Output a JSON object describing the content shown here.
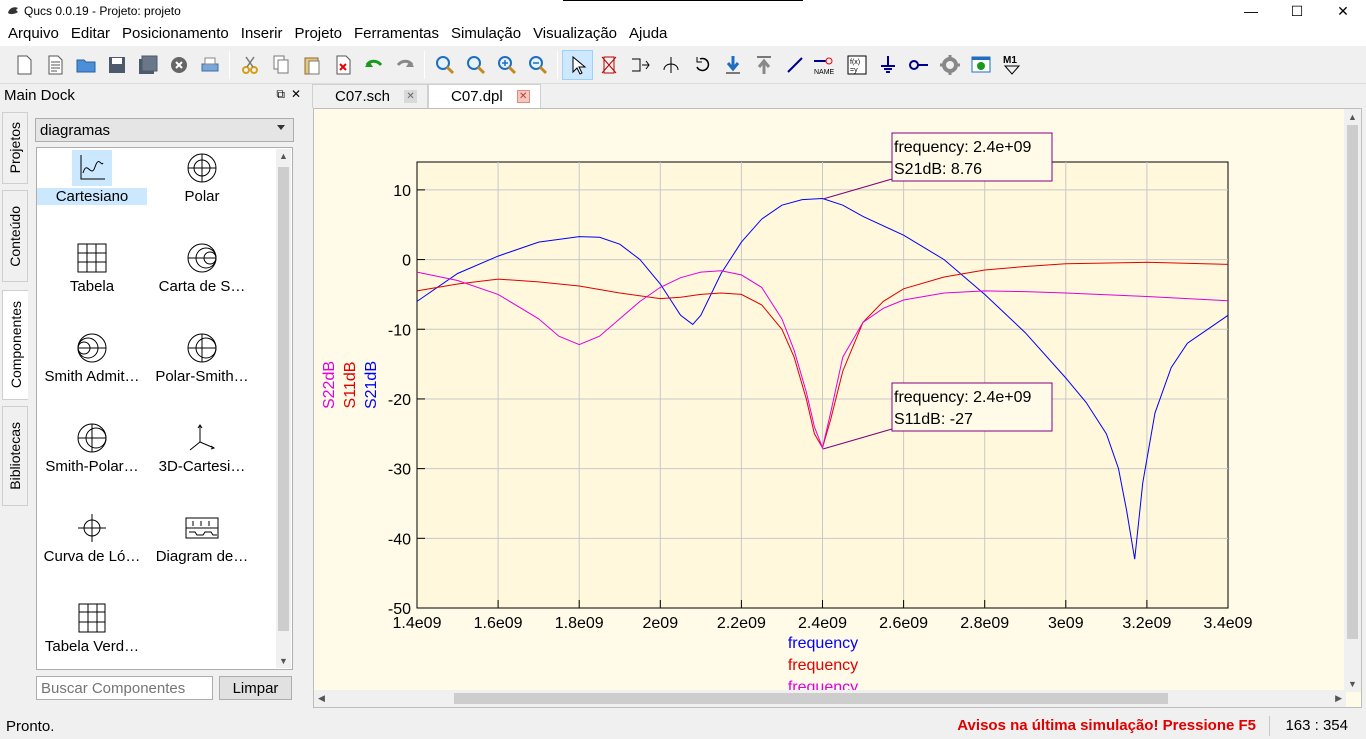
{
  "window": {
    "title": "Qucs 0.0.19 - Projeto: projeto",
    "minimize": "—",
    "maximize": "☐",
    "close": "✕"
  },
  "menu": [
    "Arquivo",
    "Editar",
    "Posicionamento",
    "Inserir",
    "Projeto",
    "Ferramentas",
    "Simulação",
    "Visualização",
    "Ajuda"
  ],
  "dock": {
    "title": "Main Dock",
    "side_tabs": [
      "Projetos",
      "Conteúdo",
      "Componentes",
      "Bibliotecas"
    ],
    "category": "diagramas",
    "components": [
      {
        "label": "Cartesiano",
        "icon": "cartesian-diagram-icon"
      },
      {
        "label": "Polar",
        "icon": "polar-diagram-icon"
      },
      {
        "label": "Tabela",
        "icon": "table-diagram-icon"
      },
      {
        "label": "Carta de S…",
        "icon": "smith-chart-icon"
      },
      {
        "label": "Smith Admit…",
        "icon": "smith-admittance-icon"
      },
      {
        "label": "Polar-Smith…",
        "icon": "polar-smith-icon"
      },
      {
        "label": "Smith-Polar…",
        "icon": "smith-polar-icon"
      },
      {
        "label": "3D-Cartesi…",
        "icon": "3d-cartesian-icon"
      },
      {
        "label": "Curva de Ló…",
        "icon": "locus-curve-icon"
      },
      {
        "label": "Diagram de…",
        "icon": "timing-diagram-icon"
      },
      {
        "label": "Tabela Verd…",
        "icon": "truth-table-icon"
      }
    ],
    "search_placeholder": "Buscar Componentes",
    "clear_label": "Limpar"
  },
  "tabs": [
    {
      "label": "C07.sch",
      "active": false
    },
    {
      "label": "C07.dpl",
      "active": true
    }
  ],
  "markers": [
    {
      "line1": "frequency: 2.4e+09",
      "line2": "S21dB: 8.76"
    },
    {
      "line1": "frequency: 2.4e+09",
      "line2": "S11dB: -27"
    }
  ],
  "chart_data": {
    "type": "line",
    "xlabel": "frequency",
    "xlim": [
      1400000000,
      3400000000
    ],
    "ylim": [
      -50,
      14
    ],
    "x_ticks": [
      "1.4e09",
      "1.6e09",
      "1.8e09",
      "2e09",
      "2.2e09",
      "2.4e09",
      "2.6e09",
      "2.8e09",
      "3e09",
      "3.2e09",
      "3.4e09"
    ],
    "y_ticks": [
      "10",
      "0",
      "-10",
      "-20",
      "-30",
      "-40",
      "-50"
    ],
    "y_tick_values": [
      10,
      0,
      -10,
      -20,
      -30,
      -40,
      -50
    ],
    "grid": true,
    "x_axis_labels": [
      "frequency",
      "frequency",
      "frequency"
    ],
    "x_axis_label_colors": [
      "#0000ff",
      "#e00000",
      "#e000e0"
    ],
    "y_axis_labels": [
      "S22dB",
      "S11dB",
      "S21dB"
    ],
    "y_axis_label_colors": [
      "#e000e0",
      "#e00000",
      "#0000ff"
    ],
    "series": [
      {
        "name": "S21dB",
        "color": "#0000ff",
        "x": [
          1400000000.0,
          1500000000.0,
          1600000000.0,
          1700000000.0,
          1800000000.0,
          1850000000.0,
          1900000000.0,
          1950000000.0,
          2000000000.0,
          2050000000.0,
          2080000000.0,
          2100000000.0,
          2150000000.0,
          2200000000.0,
          2250000000.0,
          2300000000.0,
          2350000000.0,
          2400000000.0,
          2450000000.0,
          2500000000.0,
          2600000000.0,
          2700000000.0,
          2800000000.0,
          2900000000.0,
          3000000000.0,
          3050000000.0,
          3100000000.0,
          3130000000.0,
          3150000000.0,
          3170000000.0,
          3190000000.0,
          3220000000.0,
          3260000000.0,
          3300000000.0,
          3350000000.0,
          3400000000.0
        ],
        "y": [
          -6,
          -2,
          0.5,
          2.5,
          3.3,
          3.2,
          2.2,
          0,
          -3.5,
          -8,
          -9.3,
          -8,
          -2,
          2.5,
          5.8,
          7.8,
          8.6,
          8.76,
          7.8,
          6.2,
          3.5,
          0,
          -5,
          -10.5,
          -17,
          -20.5,
          -25,
          -30,
          -36,
          -43,
          -32,
          -22,
          -15.5,
          -12,
          -10,
          -8
        ]
      },
      {
        "name": "S11dB",
        "color": "#e00000",
        "x": [
          1400000000.0,
          1500000000.0,
          1600000000.0,
          1700000000.0,
          1800000000.0,
          1900000000.0,
          2000000000.0,
          2050000000.0,
          2100000000.0,
          2150000000.0,
          2200000000.0,
          2250000000.0,
          2300000000.0,
          2330000000.0,
          2360000000.0,
          2380000000.0,
          2400000000.0,
          2420000000.0,
          2450000000.0,
          2500000000.0,
          2550000000.0,
          2600000000.0,
          2700000000.0,
          2800000000.0,
          2900000000.0,
          3000000000.0,
          3200000000.0,
          3400000000.0
        ],
        "y": [
          -4.5,
          -3.5,
          -2.8,
          -3.2,
          -3.8,
          -4.8,
          -5.6,
          -5.4,
          -5.0,
          -4.8,
          -5.0,
          -6.5,
          -10,
          -14,
          -20,
          -25,
          -27,
          -23,
          -16,
          -9,
          -6,
          -4.2,
          -2.5,
          -1.5,
          -1.0,
          -0.6,
          -0.4,
          -0.7
        ]
      },
      {
        "name": "S22dB",
        "color": "#e000e0",
        "x": [
          1400000000.0,
          1500000000.0,
          1600000000.0,
          1700000000.0,
          1750000000.0,
          1800000000.0,
          1850000000.0,
          1900000000.0,
          1950000000.0,
          2000000000.0,
          2050000000.0,
          2100000000.0,
          2150000000.0,
          2200000000.0,
          2250000000.0,
          2300000000.0,
          2330000000.0,
          2360000000.0,
          2380000000.0,
          2400000000.0,
          2420000000.0,
          2450000000.0,
          2500000000.0,
          2550000000.0,
          2600000000.0,
          2700000000.0,
          2800000000.0,
          2900000000.0,
          3000000000.0,
          3200000000.0,
          3400000000.0
        ],
        "y": [
          -1.8,
          -3,
          -5,
          -8.5,
          -11,
          -12.2,
          -11,
          -8.5,
          -6,
          -4,
          -2.6,
          -1.8,
          -1.6,
          -2.2,
          -4,
          -8.5,
          -13,
          -19,
          -24,
          -27,
          -22,
          -14,
          -9,
          -7,
          -5.8,
          -4.8,
          -4.5,
          -4.6,
          -4.8,
          -5.3,
          -5.9
        ]
      }
    ]
  },
  "status": {
    "left": "Pronto.",
    "warning": "Avisos na última simulação! Pressione F5",
    "coords": "163 : 354"
  }
}
